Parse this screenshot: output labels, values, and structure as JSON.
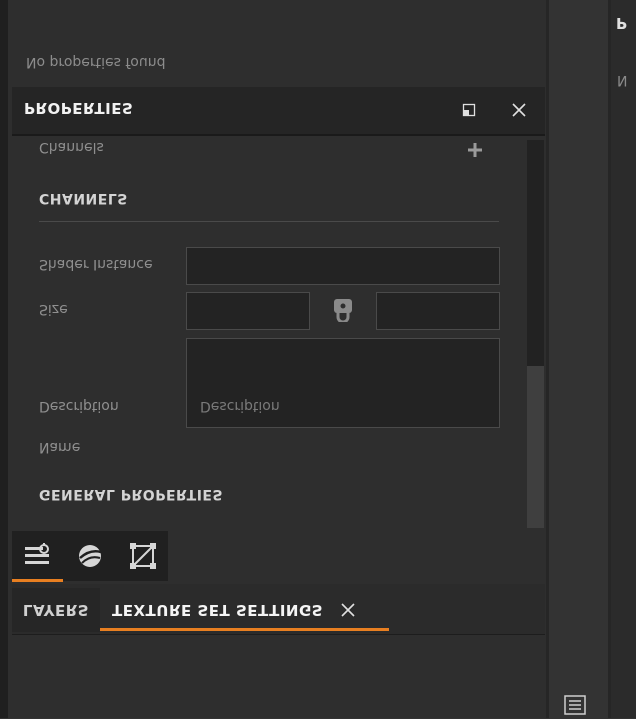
{
  "properties_panel": {
    "title": "PROPERTIES",
    "no_properties_text": "No properties found",
    "sections": {
      "channels_title": "CHANNELS",
      "channels_label": "Channels",
      "general_title": "GENERAL PROPERTIES"
    },
    "fields": {
      "shader_instance_label": "Shader Instance",
      "size_label": "Size",
      "description_label": "Description",
      "description_placeholder": "Description",
      "name_label": "Name"
    }
  },
  "tabs": [
    {
      "label": "LAYERS"
    },
    {
      "label": "TEXTURE SET SETTINGS"
    }
  ],
  "icons": [
    "restore-icon",
    "close-icon",
    "add-icon",
    "lock-icon",
    "layers-settings-icon",
    "material-icon",
    "transform-icon",
    "menu-icon"
  ],
  "colors": {
    "accent": "#e87f21",
    "panel_bg": "#2e2e2e",
    "header_bg": "#252525"
  }
}
